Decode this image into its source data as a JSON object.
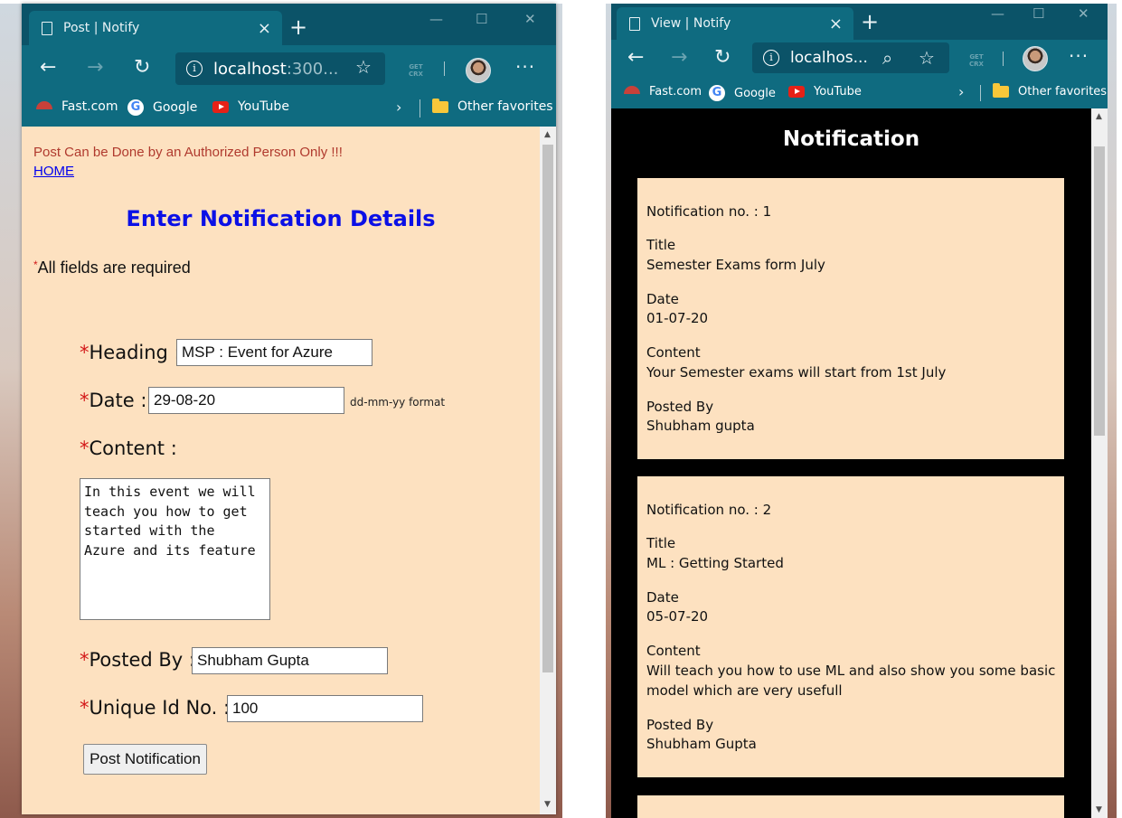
{
  "left_window": {
    "tab_title": "Post | Notify",
    "address_host": "localhost",
    "address_port": ":300...",
    "favorites": [
      "Fast.com",
      "Google",
      "YouTube"
    ],
    "other_favorites": "Other favorites",
    "warning": "Post Can be Done by an Authorized Person Only !!!",
    "home_link": "HOME",
    "form_heading": "Enter Notification Details",
    "required_note": "All fields are required",
    "fields": {
      "heading_label": "Heading :",
      "heading_value": "MSP : Event for Azure",
      "date_label": "Date :",
      "date_value": "29-08-20",
      "date_hint": "dd-mm-yy format",
      "content_label": "Content :",
      "content_value": "In this event we will\nteach you how to get\nstarted with the\nAzure and its feature",
      "posted_by_label": "Posted By :",
      "posted_by_value": "Shubham Gupta",
      "unique_id_label": "Unique Id No. :",
      "unique_id_value": "100"
    },
    "submit_label": "Post Notification"
  },
  "right_window": {
    "tab_title": "View | Notify",
    "address_host": "localhos...",
    "favorites": [
      "Fast.com",
      "Google",
      "YouTube"
    ],
    "other_favorites": "Other favorites",
    "page_title": "Notification",
    "notifications": [
      {
        "number_line": "Notification no. : 1",
        "title_label": "Title",
        "title": "Semester Exams form July",
        "date_label": "Date",
        "date": "01-07-20",
        "content_label": "Content",
        "content": "Your Semester exams will start from 1st July",
        "posted_by_label": "Posted By",
        "posted_by": "Shubham gupta"
      },
      {
        "number_line": "Notification no. : 2",
        "title_label": "Title",
        "title": "ML : Getting Started",
        "date_label": "Date",
        "date": "05-07-20",
        "content_label": "Content",
        "content_line1": "Will teach you how to use ML and also show you some basic",
        "content_line2": "model which are very usefull",
        "posted_by_label": "Posted By",
        "posted_by": "Shubham Gupta"
      }
    ]
  },
  "colors": {
    "browser_chrome": "#0f6b80",
    "titlebar": "#0b5368",
    "page_background": "#fde1c0",
    "heading_blue": "#0b10e6",
    "required_red": "#d31919",
    "warning_red": "#b03a2e"
  }
}
